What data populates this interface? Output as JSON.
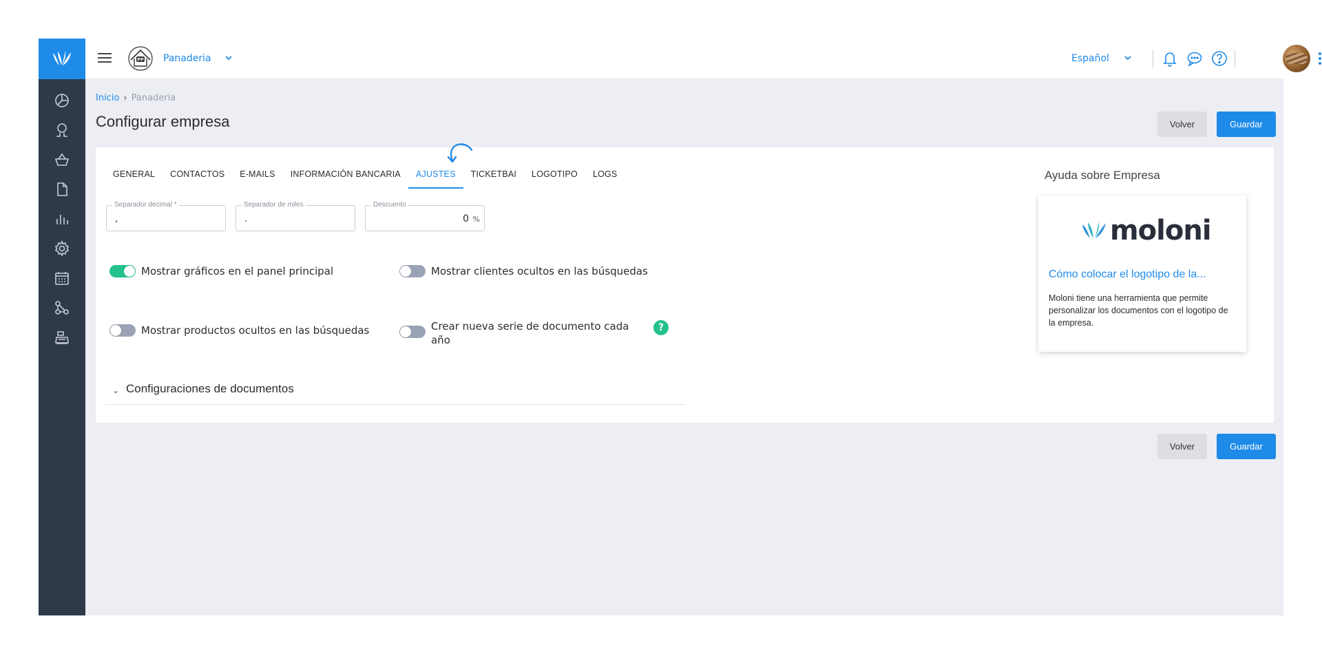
{
  "topbar": {
    "company_name": "Panaderia",
    "language": "Español"
  },
  "breadcrumb": {
    "home": "Inicio",
    "separator": "›",
    "current": "Panaderia"
  },
  "page": {
    "title": "Configurar empresa",
    "back_label": "Volver",
    "save_label": "Guardar"
  },
  "tabs": [
    {
      "label": "GENERAL",
      "active": false
    },
    {
      "label": "CONTACTOS",
      "active": false
    },
    {
      "label": "E-MAILS",
      "active": false
    },
    {
      "label": "INFORMACIÓN BANCARIA",
      "active": false
    },
    {
      "label": "AJUSTES",
      "active": true
    },
    {
      "label": "TICKETBAI",
      "active": false
    },
    {
      "label": "LOGOTIPO",
      "active": false
    },
    {
      "label": "LOGS",
      "active": false
    }
  ],
  "fields": {
    "decimal_separator": {
      "label": "Separador decimal *",
      "value": ","
    },
    "thousands_separator": {
      "label": "Separador de miles",
      "value": "."
    },
    "discount": {
      "label": "Descuento",
      "value": "0",
      "suffix": "%"
    }
  },
  "toggles": {
    "show_charts": {
      "label": "Mostrar gráficos en el panel principal",
      "on": true
    },
    "show_hidden_clients": {
      "label": "Mostrar clientes ocultos en las búsquedas",
      "on": false
    },
    "show_hidden_products": {
      "label": "Mostrar productos ocultos en las búsquedas",
      "on": false
    },
    "new_series_yearly": {
      "label_line1": "Crear nueva serie de documento cada",
      "label_line2": "año",
      "on": false
    }
  },
  "help_badge": "?",
  "section": {
    "chevron": "⌄",
    "title": "Configuraciones de documentos"
  },
  "help": {
    "title": "Ayuda sobre Empresa",
    "logo_text": "moloni",
    "article_title": "Cómo colocar el logotipo de la...",
    "article_text": "Moloni tiene una herramienta que permite personalizar los documentos con el logotipo de la empresa."
  },
  "colors": {
    "accent": "#1f8be8",
    "sidebar": "#2e3a4a",
    "toggle_on": "#25c18c",
    "toggle_off": "#9aa3b5"
  },
  "icons": {
    "sidebar": [
      "dashboard-icon",
      "customers-icon",
      "shop-basket-icon",
      "document-icon",
      "reports-icon",
      "settings-icon",
      "calendar-icon",
      "integrations-icon",
      "pos-icon"
    ],
    "topbar": [
      "menu-icon",
      "notifications-bell-icon",
      "chat-icon",
      "help-icon",
      "more-vertical-icon"
    ]
  }
}
